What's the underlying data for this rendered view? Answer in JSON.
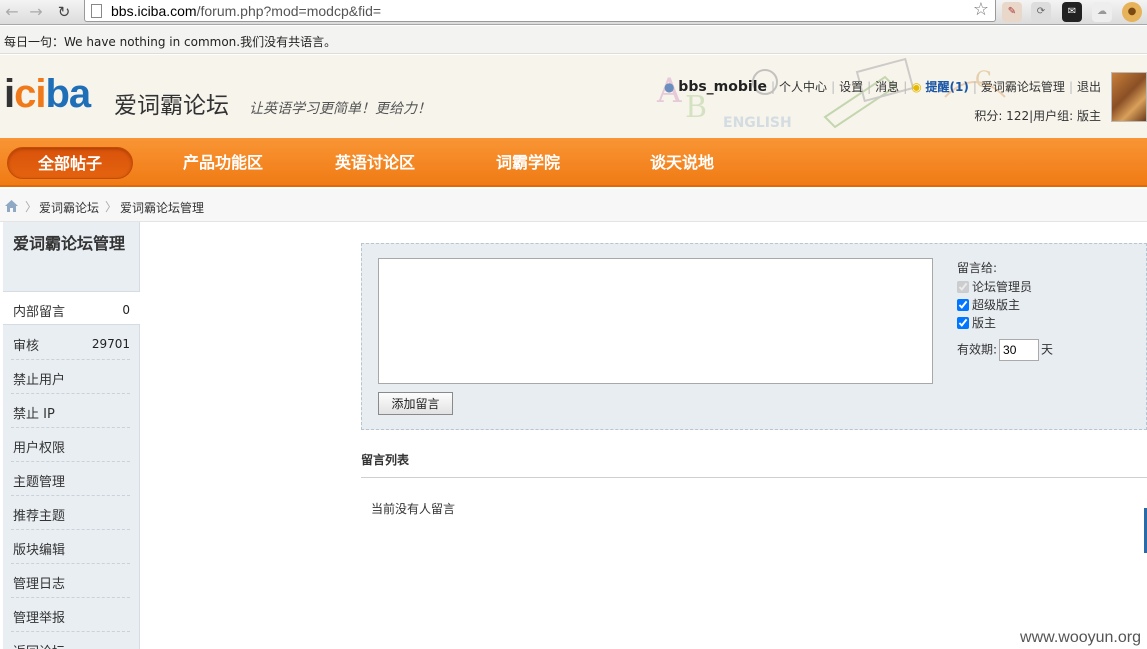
{
  "browser": {
    "url_host": "bbs.iciba.com",
    "url_path": "/forum.php?mod=modcp&fid="
  },
  "daily": {
    "text": "每日一句：We have nothing in common.我们没有共语言。"
  },
  "header": {
    "logo_text": "iciba",
    "logo_cn": "爱词霸论坛",
    "slogan": "让英语学习更简单！更给力！",
    "username": "bbs_mobile",
    "links": [
      "个人中心",
      "设置",
      "消息"
    ],
    "notice": "提醒(1)",
    "admin_link": "爱词霸论坛管理",
    "logout": "退出",
    "points": "积分: 122",
    "usergroup": "用户组: 版主"
  },
  "mainnav": {
    "tabs": [
      "全部帖子",
      "产品功能区",
      "英语讨论区",
      "词霸学院",
      "谈天说地"
    ]
  },
  "breadcrumb": [
    "爱词霸论坛",
    "爱词霸论坛管理"
  ],
  "sidebar": {
    "title": "爱词霸论坛管理",
    "items": [
      {
        "label": "内部留言",
        "count": "0"
      },
      {
        "label": "审核",
        "count": "29701"
      },
      {
        "label": "禁止用户",
        "count": ""
      },
      {
        "label": "禁止 IP",
        "count": ""
      },
      {
        "label": "用户权限",
        "count": ""
      },
      {
        "label": "主题管理",
        "count": ""
      },
      {
        "label": "推荐主题",
        "count": ""
      },
      {
        "label": "版块编辑",
        "count": ""
      },
      {
        "label": "管理日志",
        "count": ""
      },
      {
        "label": "管理举报",
        "count": ""
      },
      {
        "label": "返回论坛",
        "count": ""
      }
    ]
  },
  "message_form": {
    "add_button": "添加留言",
    "recipients_label": "留言给:",
    "recipients": [
      {
        "label": "论坛管理员",
        "checked": true,
        "disabled": true
      },
      {
        "label": "超级版主",
        "checked": true,
        "disabled": false
      },
      {
        "label": "版主",
        "checked": true,
        "disabled": false
      }
    ],
    "expire_label": "有效期:",
    "expire_value": "30",
    "expire_unit": "天"
  },
  "message_list": {
    "heading": "留言列表",
    "empty_text": "当前没有人留言"
  },
  "watermark": "www.wooyun.org",
  "colors": {
    "nav_orange": "#f48a24",
    "sidebar_bg": "#e9eef3",
    "form_bg": "#e8edf2",
    "link_blue": "#1a56a6"
  }
}
